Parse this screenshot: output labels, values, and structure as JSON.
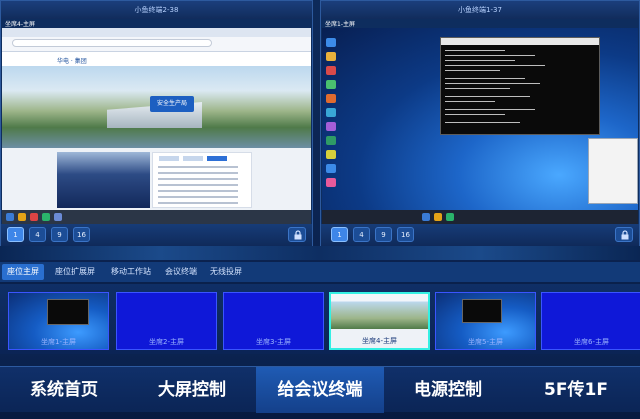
{
  "left_panel": {
    "title": "小鱼终端2-38",
    "label": "坐席4-主屏",
    "buttons": [
      "1",
      "4",
      "9",
      "16"
    ],
    "active_button": "1",
    "site_logo": "华电 · 集团",
    "safety_button": "安全生产局"
  },
  "right_panel": {
    "title": "小鱼终端1-37",
    "label": "坐席1-主屏",
    "buttons": [
      "1",
      "4",
      "9",
      "16"
    ],
    "active_button": "1"
  },
  "tabs": [
    {
      "label": "座位主屏",
      "active": true
    },
    {
      "label": "座位扩展屏",
      "active": false
    },
    {
      "label": "移动工作站",
      "active": false
    },
    {
      "label": "会议终端",
      "active": false
    },
    {
      "label": "无线投屏",
      "active": false
    }
  ],
  "thumbnails": [
    {
      "label": "坐席1-主屏",
      "kind": "cmd"
    },
    {
      "label": "坐席2-主屏",
      "kind": "blue"
    },
    {
      "label": "坐席3-主屏",
      "kind": "blue"
    },
    {
      "label": "坐席4-主屏",
      "kind": "browser",
      "selected": true
    },
    {
      "label": "坐席5-主屏",
      "kind": "desktop"
    },
    {
      "label": "坐席6-主屏",
      "kind": "blue"
    }
  ],
  "nav": [
    {
      "label": "系统首页",
      "active": false
    },
    {
      "label": "大屏控制",
      "active": false
    },
    {
      "label": "给会议终端",
      "active": true
    },
    {
      "label": "电源控制",
      "active": false
    },
    {
      "label": "5F传1F",
      "active": false
    }
  ]
}
